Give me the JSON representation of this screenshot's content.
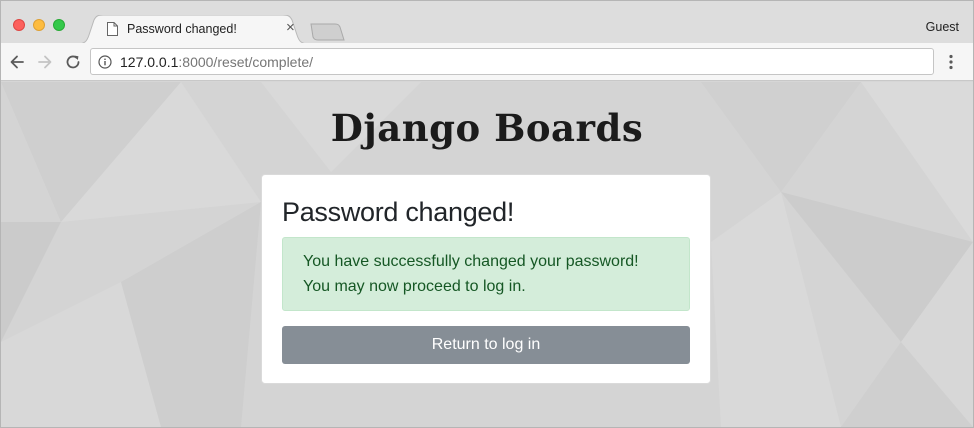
{
  "browser": {
    "tab": {
      "title": "Password changed!",
      "close_glyph": "×"
    },
    "profile": "Guest",
    "address": {
      "host": "127.0.0.1",
      "path": ":8000/reset/complete/"
    },
    "icons": {
      "back": "back-arrow-icon",
      "forward": "forward-arrow-icon",
      "reload": "reload-icon",
      "info": "info-icon",
      "menu": "vertical-dots-icon",
      "page": "page-icon"
    },
    "colors": {
      "close": "#fc605c",
      "minimize": "#fdbc40",
      "zoom": "#34c84a"
    }
  },
  "page": {
    "brand": "Django Boards",
    "card": {
      "title": "Password changed!",
      "alert_lines": [
        "You have successfully changed your password!",
        "You may now proceed to log in."
      ],
      "button_label": "Return to log in"
    },
    "colors": {
      "alert_bg": "#d4edda",
      "alert_text": "#155724",
      "button_bg": "#868e96"
    }
  }
}
